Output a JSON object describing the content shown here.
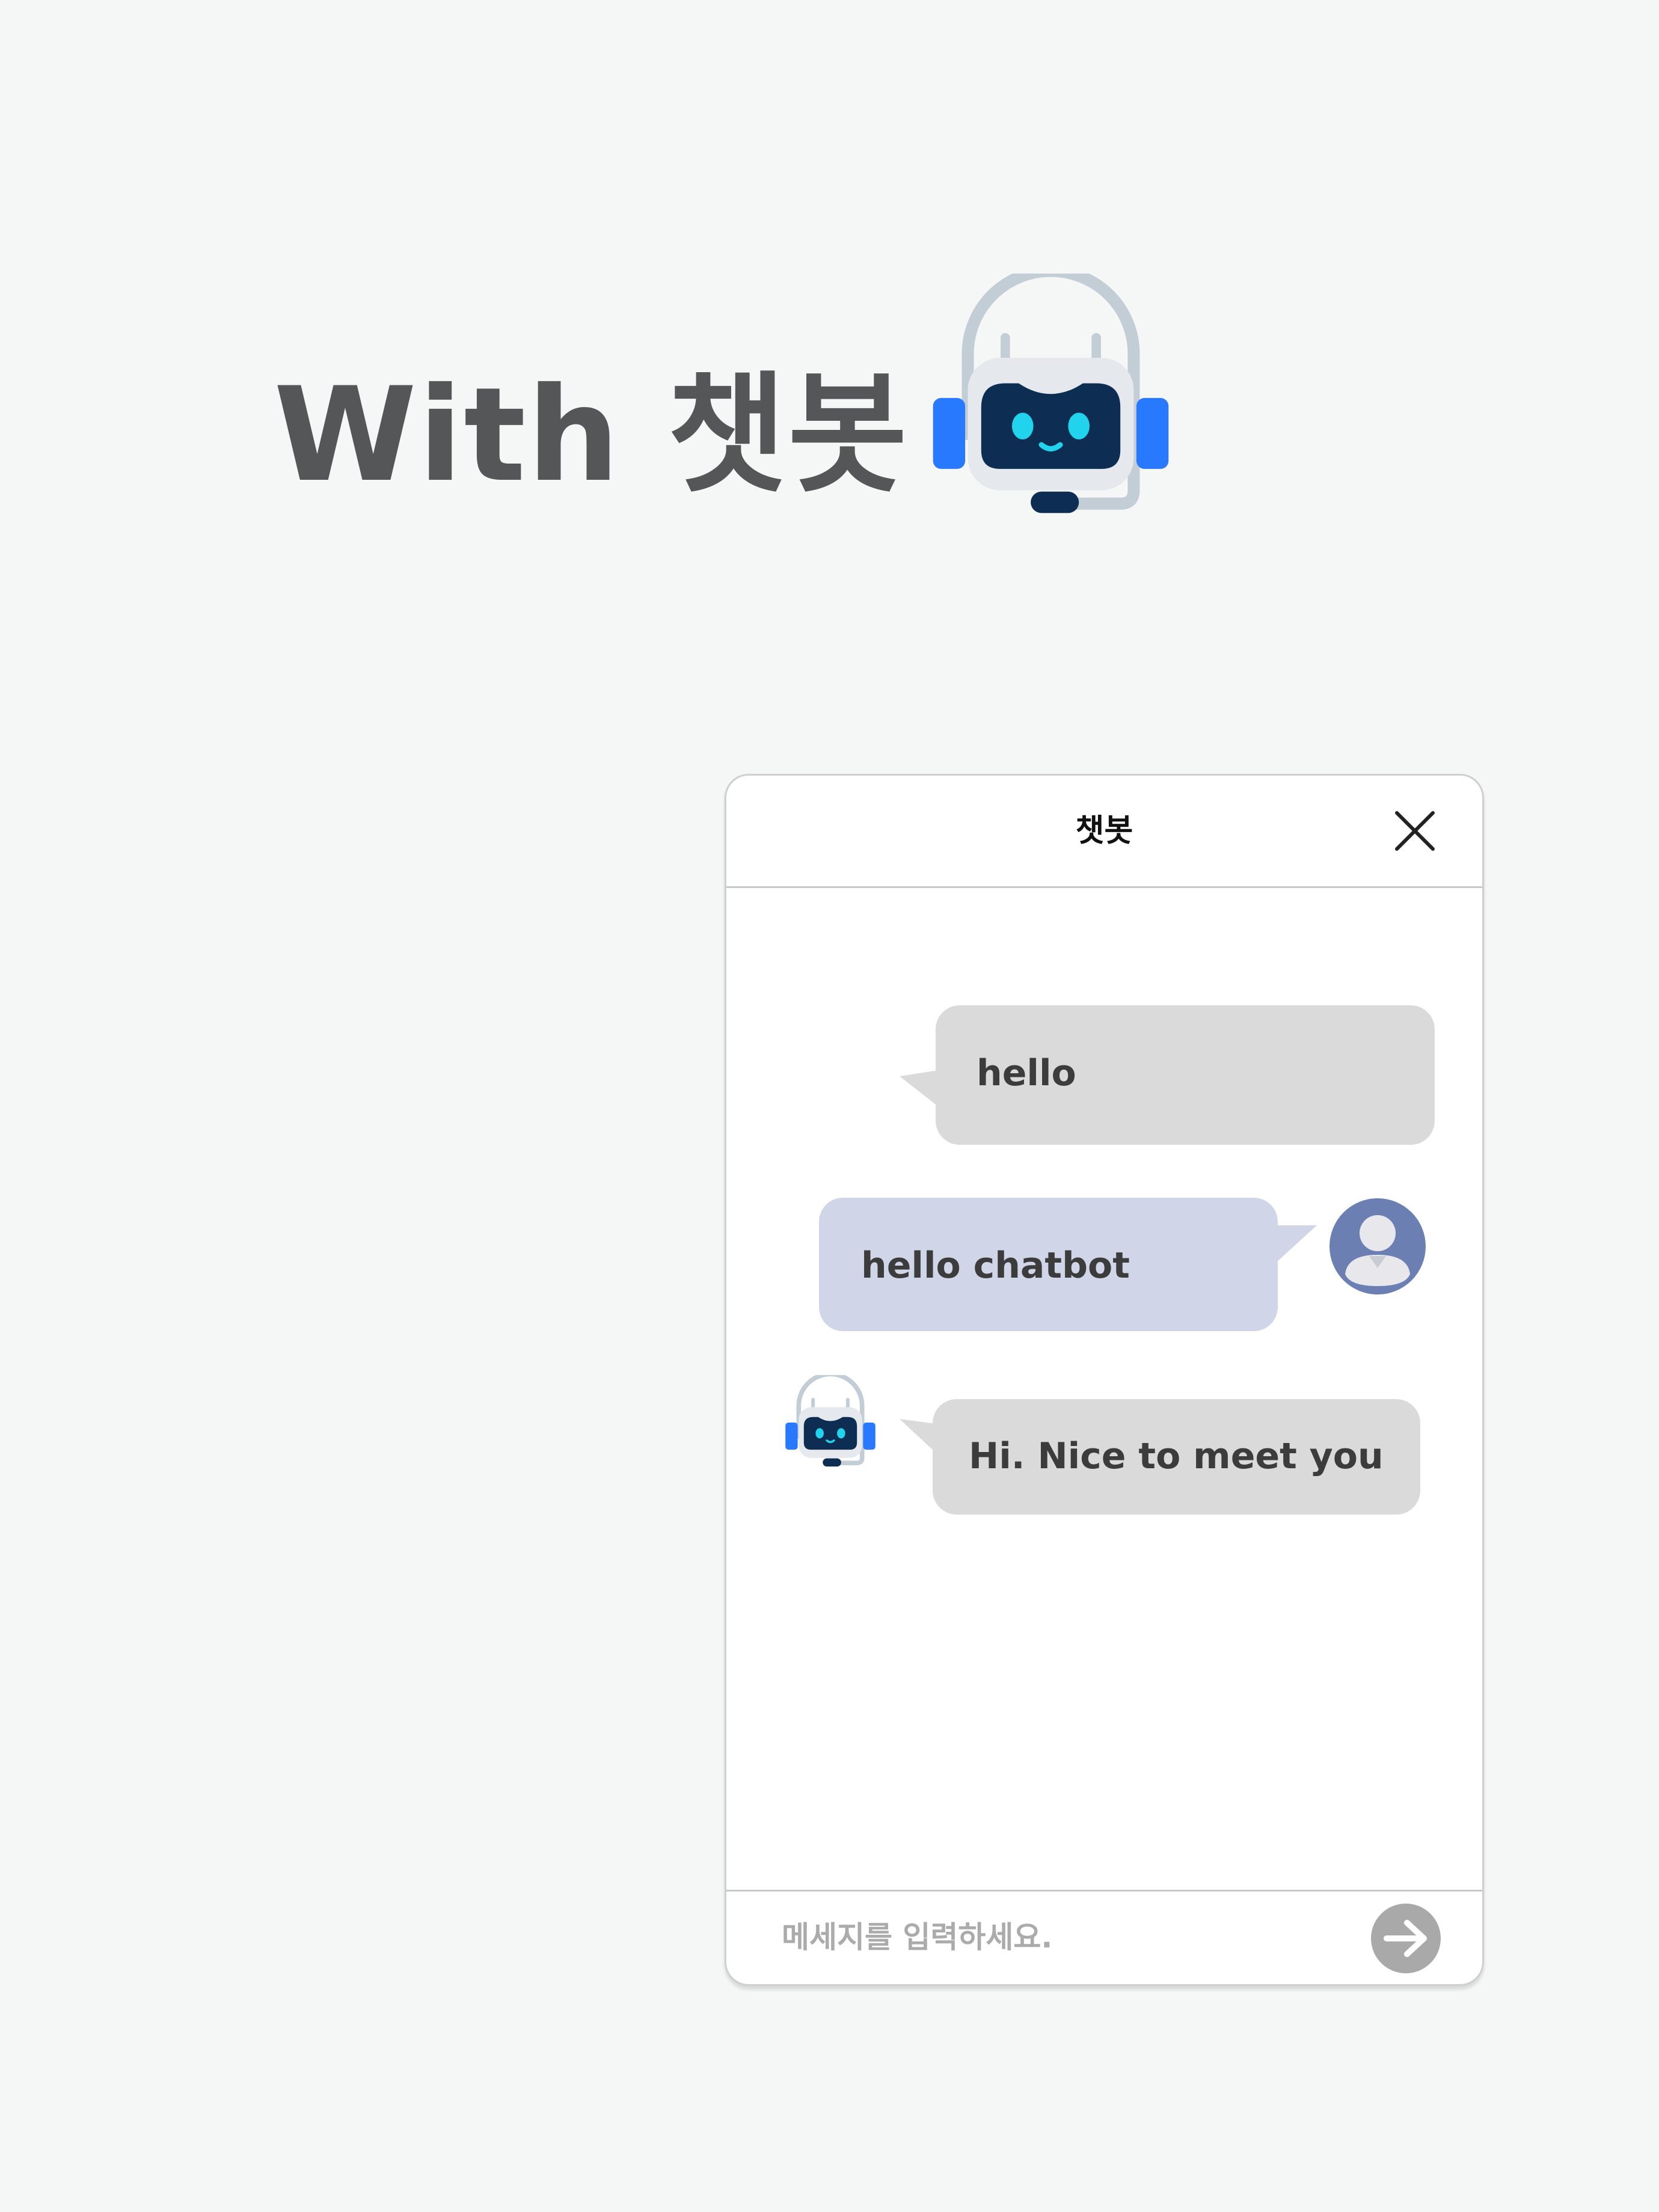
{
  "hero": {
    "title": "With 챗봇",
    "icon": "chatbot-headset-icon"
  },
  "chat": {
    "title": "챗봇",
    "close_icon": "close-icon",
    "messages": [
      {
        "sender": "bot",
        "text": "hello"
      },
      {
        "sender": "user",
        "text": "hello chatbot"
      },
      {
        "sender": "bot",
        "text": "Hi. Nice to meet you"
      }
    ],
    "input": {
      "placeholder": "메세지를 입력하세요.",
      "value": ""
    },
    "send_icon": "arrow-right-circle-icon",
    "user_avatar_icon": "user-avatar-icon",
    "bot_avatar_icon": "chatbot-headset-icon"
  },
  "colors": {
    "background": "#f5f6f6",
    "bot_bubble": "#dadada",
    "user_bubble": "#d0d5e8",
    "accent_blue": "#2979ff",
    "bot_face": "#0d2d52",
    "bot_eyes": "#22d3ee",
    "user_avatar": "#6b7fb3"
  }
}
